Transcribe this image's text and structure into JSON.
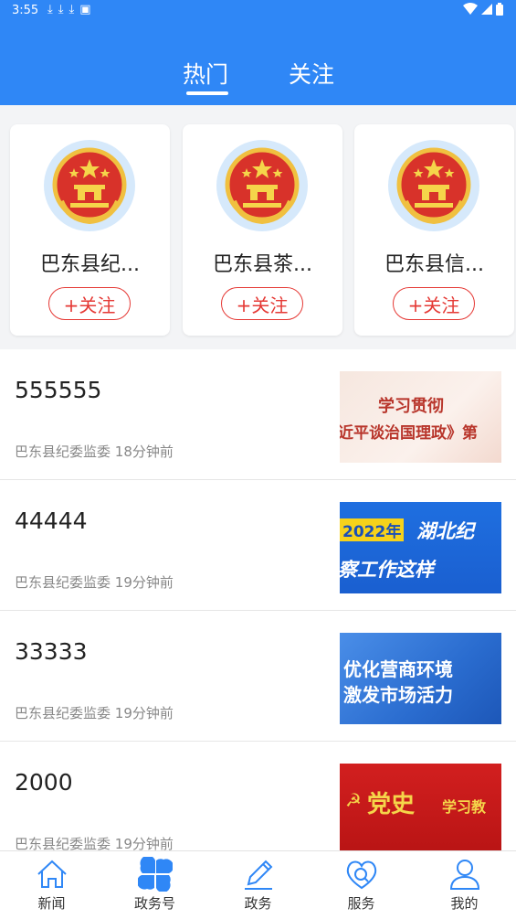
{
  "status_bar": {
    "time": "3:55",
    "notice_icons": [
      "download-icon",
      "download-icon",
      "download-icon",
      "app-icon"
    ],
    "right_icons": [
      "wifi-icon",
      "signal-icon",
      "battery-icon"
    ]
  },
  "header": {
    "tabs": [
      {
        "label": "热门",
        "active": true
      },
      {
        "label": "关注",
        "active": false
      }
    ],
    "background": "#2f87f6"
  },
  "accounts": [
    {
      "name": "巴东县纪...",
      "follow_label": "+关注"
    },
    {
      "name": "巴东县茶...",
      "follow_label": "+关注"
    },
    {
      "name": "巴东县信...",
      "follow_label": "+关注"
    }
  ],
  "news": [
    {
      "title": "555555",
      "source": "巴东县纪委监委",
      "time": "18分钟前",
      "thumb_text": [
        "学习贯彻",
        "近平谈治国理政》第"
      ]
    },
    {
      "title": "44444",
      "source": "巴东县纪委监委",
      "time": "19分钟前",
      "thumb_text": [
        "2022年",
        "湖北纪",
        "察工作这样"
      ]
    },
    {
      "title": "33333",
      "source": "巴东县纪委监委",
      "time": "19分钟前",
      "thumb_text": [
        "优化营商环境",
        "激发市场活力"
      ]
    },
    {
      "title": "2000",
      "source": "巴东县纪委监委",
      "time": "19分钟前",
      "thumb_text": [
        "党史",
        "学习教"
      ]
    }
  ],
  "bottom_nav": [
    {
      "label": "新闻",
      "icon": "home-icon",
      "active": false
    },
    {
      "label": "政务号",
      "icon": "clover-icon",
      "active": true
    },
    {
      "label": "政务",
      "icon": "pencil-icon",
      "active": false
    },
    {
      "label": "服务",
      "icon": "heart-service-icon",
      "active": false
    },
    {
      "label": "我的",
      "icon": "user-icon",
      "active": false
    }
  ],
  "colors": {
    "accent": "#2f87f6",
    "follow_red": "#e53935",
    "emblem_bg": "#d6e9fb"
  }
}
